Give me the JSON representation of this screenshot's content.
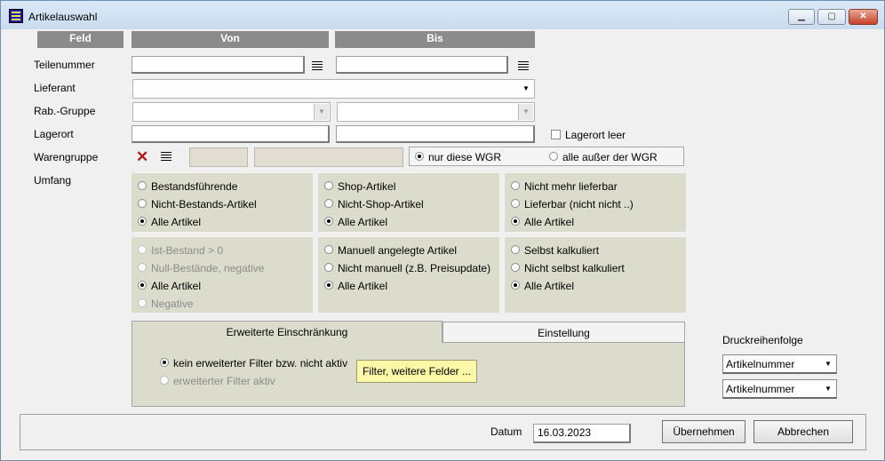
{
  "window": {
    "title": "Artikelauswahl"
  },
  "headers": {
    "feld": "Feld",
    "von": "Von",
    "bis": "Bis"
  },
  "labels": {
    "teilenummer": "Teilenummer",
    "lieferant": "Lieferant",
    "rabgruppe": "Rab.-Gruppe",
    "lagerort": "Lagerort",
    "warengruppe": "Warengruppe",
    "umfang": "Umfang"
  },
  "lagerort_leer": "Lagerort leer",
  "wgr_options": {
    "only": "nur diese WGR",
    "all_except": "alle außer der WGR",
    "selected": "only"
  },
  "umfang": {
    "group1": [
      "Bestandsführende",
      "Nicht-Bestands-Artikel",
      "Alle Artikel"
    ],
    "group2": [
      "Shop-Artikel",
      "Nicht-Shop-Artikel",
      "Alle Artikel"
    ],
    "group3": [
      "Nicht mehr lieferbar",
      "Lieferbar (nicht nicht ..)",
      "Alle Artikel"
    ],
    "group4": [
      "Ist-Bestand > 0",
      "Null-Bestände, negative",
      "Alle Artikel",
      "Negative"
    ],
    "group5": [
      "Manuell angelegte Artikel",
      "Nicht manuell (z.B. Preisupdate)",
      "Alle Artikel"
    ],
    "group6": [
      "Selbst kalkuliert",
      "Nicht selbst kalkuliert",
      "Alle Artikel"
    ]
  },
  "tabs": {
    "active": "Erweiterte Einschränkung",
    "other": "Einstellung"
  },
  "filter": {
    "opt1": "kein erweiterter Filter bzw. nicht aktiv",
    "opt2": "erweiterter Filter aktiv",
    "button": "Filter, weitere Felder ..."
  },
  "druck": {
    "label": "Druckreihenfolge",
    "sort1": "Artikelnummer",
    "sort2": "Artikelnummer"
  },
  "footer": {
    "datum_label": "Datum",
    "datum_value": "16.03.2023",
    "apply": "Übernehmen",
    "cancel": "Abbrechen"
  },
  "icons": {
    "list": "list-icon",
    "delete": "delete-x-icon",
    "dropdown": "chevron-down-icon"
  }
}
